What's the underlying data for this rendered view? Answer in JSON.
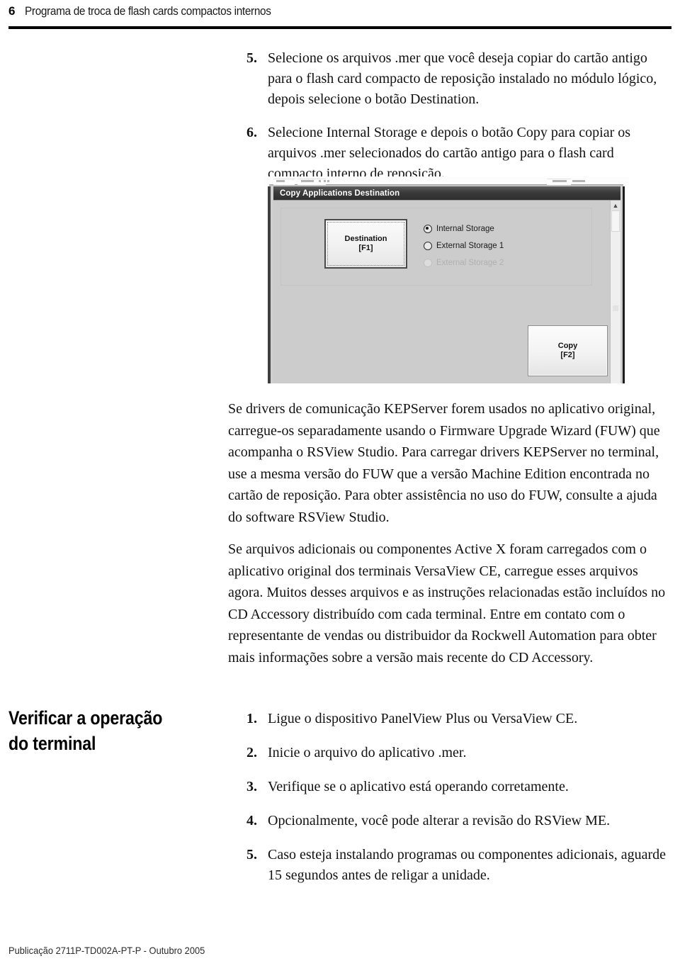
{
  "header": {
    "page_number": "6",
    "title": "Programa de troca de flash cards compactos internos"
  },
  "steps_top": [
    {
      "number": "5.",
      "text": "Selecione os arquivos .mer que você deseja copiar do cartão antigo para o flash card compacto de reposição instalado no módulo lógico, depois selecione o botão Destination."
    },
    {
      "number": "6.",
      "text": "Selecione Internal Storage e depois o botão Copy para copiar os arquivos .mer selecionados do cartão antigo para o flash card compacto interno de reposição."
    }
  ],
  "screenshot": {
    "window_title": "Copy Applications Destination",
    "destination_button": {
      "line1": "Destination",
      "line2": "[F1]"
    },
    "copy_button": {
      "line1": "Copy",
      "line2": "[F2]"
    },
    "storage_options": [
      {
        "label": "Internal Storage",
        "selected": true,
        "disabled": false
      },
      {
        "label": "External Storage 1",
        "selected": false,
        "disabled": false
      },
      {
        "label": "External Storage 2",
        "selected": false,
        "disabled": true
      }
    ],
    "scroll_up_glyph": "▲",
    "colors": {
      "titlebar": "#3a3a3a",
      "dialog_face": "#cccccc",
      "button_face": "#f3f3f3"
    }
  },
  "paragraphs": [
    "Se drivers de comunicação KEPServer forem usados no aplicativo original, carregue-os separadamente usando o Firmware Upgrade Wizard (FUW) que acompanha o RSView Studio. Para carregar drivers KEPServer no terminal, use a mesma versão do FUW que a versão Machine Edition encontrada no cartão de reposição. Para obter assistência no uso do FUW, consulte a ajuda do software RSView Studio.",
    "Se arquivos adicionais ou componentes Active X foram carregados com o aplicativo original dos terminais VersaView CE, carregue esses arquivos agora. Muitos desses arquivos e as instruções relacionadas estão incluídos no CD Accessory distribuído com cada terminal. Entre em contato com o representante de vendas ou distribuidor da Rockwell Automation para obter mais informações sobre a versão mais recente do CD Accessory."
  ],
  "verify_section": {
    "heading_line1": "Verificar a operação",
    "heading_line2": "do terminal",
    "steps": [
      {
        "number": "1.",
        "text": "Ligue o dispositivo PanelView Plus ou VersaView CE."
      },
      {
        "number": "2.",
        "text": "Inicie o arquivo do aplicativo .mer."
      },
      {
        "number": "3.",
        "text": "Verifique se o aplicativo está operando corretamente."
      },
      {
        "number": "4.",
        "text": "Opcionalmente, você pode alterar a revisão do RSView ME."
      },
      {
        "number": "5.",
        "text": "Caso esteja instalando programas ou componentes adicionais, aguarde 15 segundos antes de religar a unidade."
      }
    ]
  },
  "footer": {
    "text": "Publicação 2711P-TD002A-PT-P - Outubro 2005"
  }
}
